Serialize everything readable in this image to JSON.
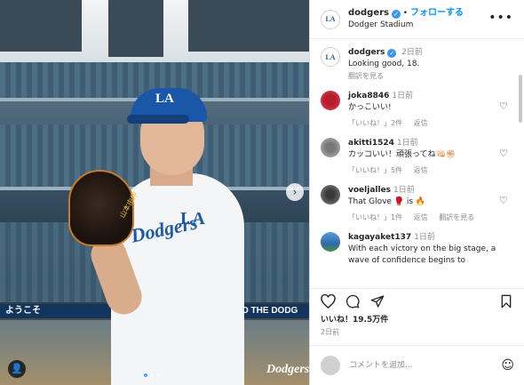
{
  "photo": {
    "stadium_banner_left": "ようこそ",
    "stadium_banner_right": "O THE DODG",
    "jersey_text": "Dodgers",
    "jersey_la": "LA",
    "cap_logo": "LA",
    "glove_text": "山本由伸",
    "watermark": "Dodgers",
    "next_icon": "chevron-right-icon",
    "tag_icon": "person-tag-icon"
  },
  "header": {
    "username": "dodgers",
    "separator": "•",
    "follow_label": "フォローする",
    "location": "Dodger Stadium",
    "more_icon": "more-horizontal-icon",
    "avatar_text": "LA"
  },
  "caption": {
    "username": "dodgers",
    "time": "2日前",
    "text": "Looking good, 18.",
    "translate": "翻訳を見る",
    "avatar_text": "LA"
  },
  "comments": [
    {
      "user": "joka8846",
      "time": "1日前",
      "text": "かっこいい!",
      "likes": "「いいね！」2件",
      "reply": "返信",
      "extra": ""
    },
    {
      "user": "akitti1524",
      "time": "1日前",
      "text": "カッコいい！頑張ってね👊🏻✊🏻",
      "likes": "「いいね！」5件",
      "reply": "返信",
      "extra": ""
    },
    {
      "user": "voeljalles",
      "time": "1日前",
      "text": "That Glove 🥊 is 🔥",
      "likes": "「いいね！」1件",
      "reply": "返信",
      "extra": "翻訳を見る"
    },
    {
      "user": "kagayaket137",
      "time": "1日前",
      "text": "With each victory on the big stage, a wave of confidence begins to",
      "likes": "",
      "reply": "",
      "extra": ""
    }
  ],
  "actions": {
    "like_icon": "heart-icon",
    "comment_icon": "comment-icon",
    "share_icon": "send-icon",
    "save_icon": "bookmark-icon"
  },
  "likes_count": "いいね！19.5万件",
  "posted": "2日前",
  "comment_box": {
    "placeholder": "コメントを追加...",
    "emoji_icon": "emoji-icon"
  }
}
